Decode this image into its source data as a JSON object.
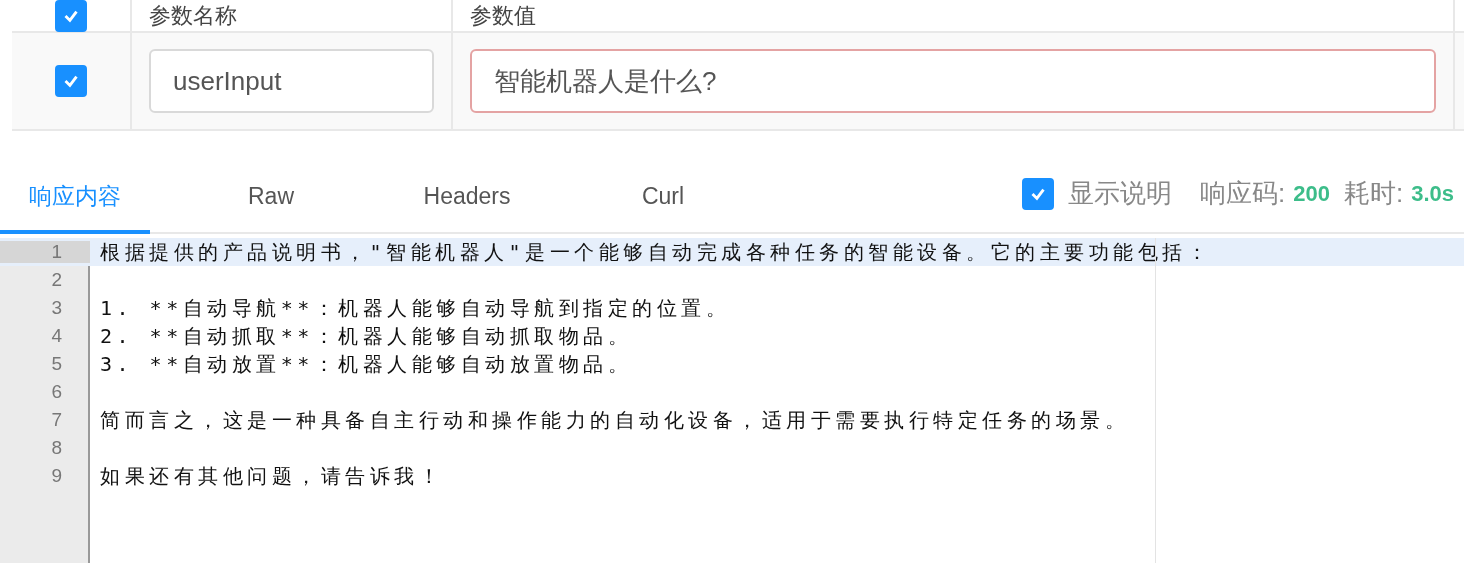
{
  "params_table": {
    "header": {
      "checked": true,
      "name": "参数名称",
      "value": "参数值"
    },
    "rows": [
      {
        "checked": true,
        "name": "userInput",
        "value": "智能机器人是什么?",
        "invalid": true
      }
    ]
  },
  "response": {
    "tabs": [
      {
        "label": "响应内容",
        "selected": true
      },
      {
        "label": "Raw",
        "selected": false
      },
      {
        "label": "Headers",
        "selected": false
      },
      {
        "label": "Curl",
        "selected": false
      }
    ],
    "show_description": {
      "label": "显示说明",
      "checked": true
    },
    "status_label": "响应码:",
    "status_code": "200",
    "time_label": "耗时:",
    "time_value": "3.0s",
    "lines": [
      {
        "number": "1",
        "text": "根据提供的产品说明书，\"智能机器人\"是一个能够自动完成各种任务的智能设备。它的主要功能包括：",
        "highlighted": true
      },
      {
        "number": "2",
        "highlighted": false
      },
      {
        "number": "3",
        "text": "1. **自动导航**：机器人能够自动导航到指定的位置。",
        "highlighted": false
      },
      {
        "number": "4",
        "text": "2. **自动抓取**：机器人能够自动抓取物品。",
        "highlighted": false
      },
      {
        "number": "5",
        "text": "3. **自动放置**：机器人能够自动放置物品。",
        "highlighted": false
      },
      {
        "number": "6",
        "highlighted": false
      },
      {
        "number": "7",
        "text": "简而言之，这是一种具备自主行动和操作能力的自动化设备，适用于需要执行特定任务的场景。",
        "highlighted": false
      },
      {
        "number": "8",
        "highlighted": false
      },
      {
        "number": "9",
        "text": "如果还有其他问题，请告诉我！",
        "highlighted": false
      }
    ]
  }
}
